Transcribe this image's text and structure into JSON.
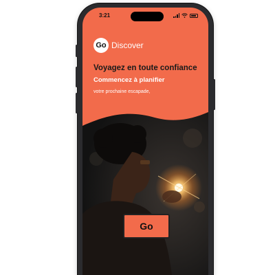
{
  "status_bar": {
    "time": "3:21",
    "icons": [
      "signal-icon",
      "wifi-icon",
      "battery-icon"
    ]
  },
  "brand": {
    "logo_text": "Go",
    "name": "Discover"
  },
  "hero": {
    "headline": "Voyagez en toute confiance",
    "subheadline": "Commencez à planifier",
    "caption": "votre prochaine escapade,"
  },
  "cta": {
    "label": "Go"
  },
  "colors": {
    "accent": "#f26b4b",
    "dark": "#1a1a1a",
    "device": "#2b2b2e"
  }
}
